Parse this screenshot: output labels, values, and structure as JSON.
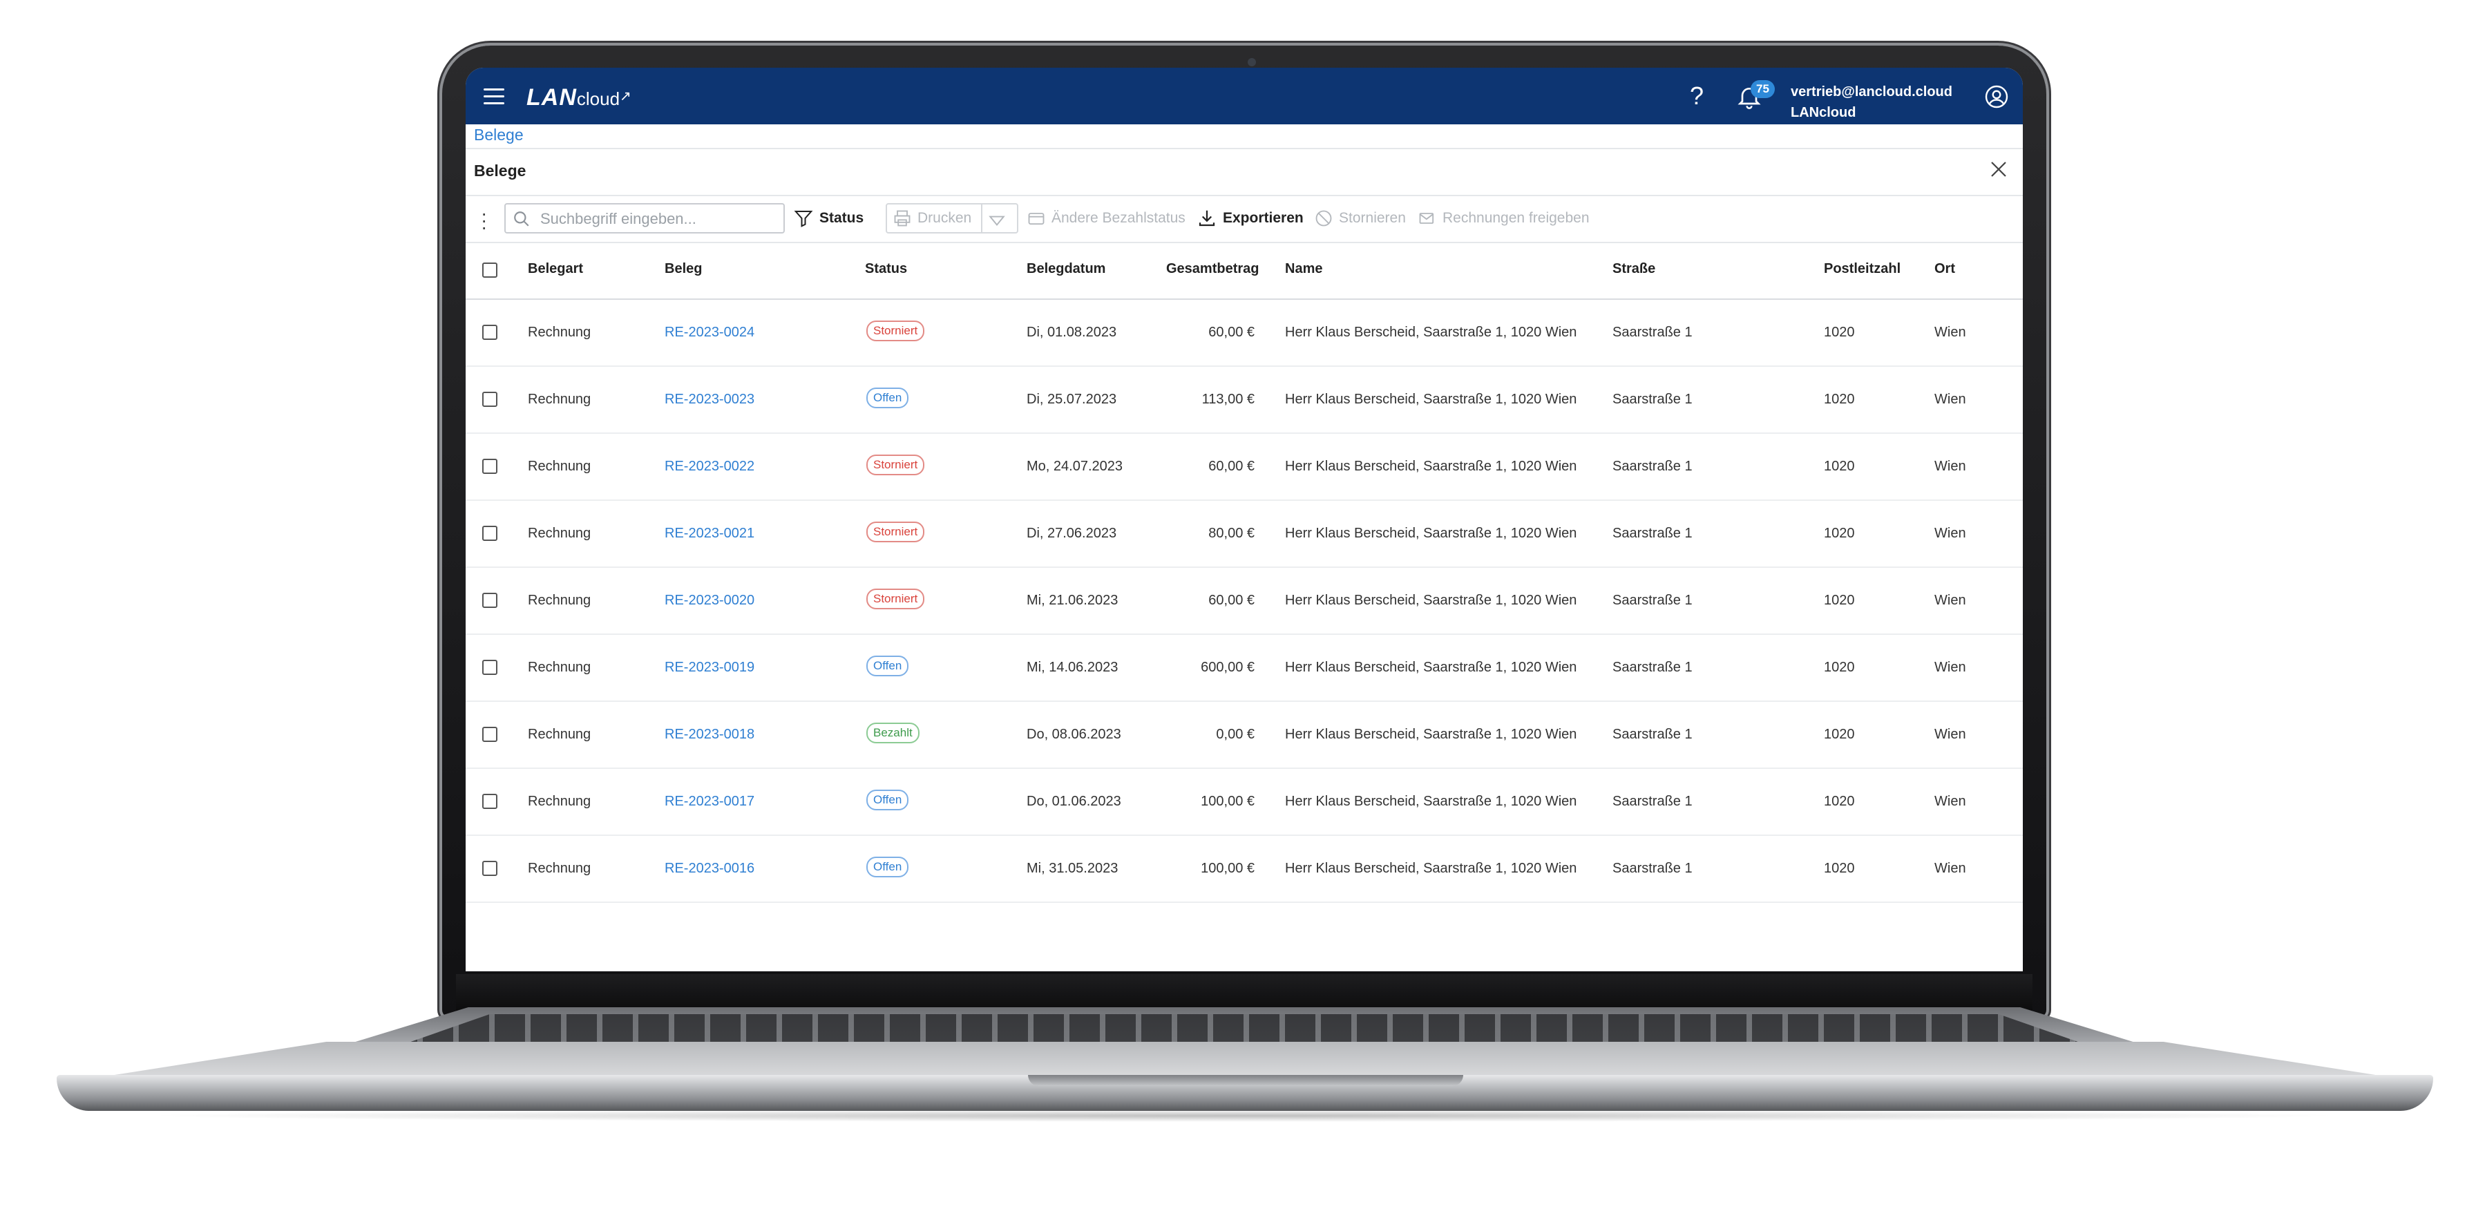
{
  "app": {
    "logo_main": "LAN",
    "logo_sub": "cloud",
    "logo_arrow": "↗",
    "help_label": "?",
    "notification_count": "75",
    "user_email": "vertrieb@lancloud.cloud",
    "user_company": "LANcloud"
  },
  "breadcrumb": "Belege",
  "page_title": "Belege",
  "toolbar": {
    "search_placeholder": "Suchbegriff eingeben...",
    "status_label": "Status",
    "print_label": "Drucken",
    "change_payment_label": "Ändere Bezahlstatus",
    "export_label": "Exportieren",
    "cancel_label": "Stornieren",
    "release_label": "Rechnungen freigeben"
  },
  "table": {
    "columns": [
      "Belegart",
      "Beleg",
      "Status",
      "Belegdatum",
      "Gesamtbetrag",
      "Name",
      "Straße",
      "Postleitzahl",
      "Ort"
    ],
    "rows": [
      {
        "type": "Rechnung",
        "id": "RE-2023-0024",
        "status": "Storniert",
        "status_kind": "storniert",
        "date": "Di, 01.08.2023",
        "amount": "60,00 €",
        "name": "Herr Klaus Berscheid, Saarstraße 1, 1020 Wien",
        "street": "Saarstraße 1",
        "zip": "1020",
        "city": "Wien"
      },
      {
        "type": "Rechnung",
        "id": "RE-2023-0023",
        "status": "Offen",
        "status_kind": "offen",
        "date": "Di, 25.07.2023",
        "amount": "113,00 €",
        "name": "Herr Klaus Berscheid, Saarstraße 1, 1020 Wien",
        "street": "Saarstraße 1",
        "zip": "1020",
        "city": "Wien"
      },
      {
        "type": "Rechnung",
        "id": "RE-2023-0022",
        "status": "Storniert",
        "status_kind": "storniert",
        "date": "Mo, 24.07.2023",
        "amount": "60,00 €",
        "name": "Herr Klaus Berscheid, Saarstraße 1, 1020 Wien",
        "street": "Saarstraße 1",
        "zip": "1020",
        "city": "Wien"
      },
      {
        "type": "Rechnung",
        "id": "RE-2023-0021",
        "status": "Storniert",
        "status_kind": "storniert",
        "date": "Di, 27.06.2023",
        "amount": "80,00 €",
        "name": "Herr Klaus Berscheid, Saarstraße 1, 1020 Wien",
        "street": "Saarstraße 1",
        "zip": "1020",
        "city": "Wien"
      },
      {
        "type": "Rechnung",
        "id": "RE-2023-0020",
        "status": "Storniert",
        "status_kind": "storniert",
        "date": "Mi, 21.06.2023",
        "amount": "60,00 €",
        "name": "Herr Klaus Berscheid, Saarstraße 1, 1020 Wien",
        "street": "Saarstraße 1",
        "zip": "1020",
        "city": "Wien"
      },
      {
        "type": "Rechnung",
        "id": "RE-2023-0019",
        "status": "Offen",
        "status_kind": "offen",
        "date": "Mi, 14.06.2023",
        "amount": "600,00 €",
        "name": "Herr Klaus Berscheid, Saarstraße 1, 1020 Wien",
        "street": "Saarstraße 1",
        "zip": "1020",
        "city": "Wien"
      },
      {
        "type": "Rechnung",
        "id": "RE-2023-0018",
        "status": "Bezahlt",
        "status_kind": "bezahlt",
        "date": "Do, 08.06.2023",
        "amount": "0,00 €",
        "name": "Herr Klaus Berscheid, Saarstraße 1, 1020 Wien",
        "street": "Saarstraße 1",
        "zip": "1020",
        "city": "Wien"
      },
      {
        "type": "Rechnung",
        "id": "RE-2023-0017",
        "status": "Offen",
        "status_kind": "offen",
        "date": "Do, 01.06.2023",
        "amount": "100,00 €",
        "name": "Herr Klaus Berscheid, Saarstraße 1, 1020 Wien",
        "street": "Saarstraße 1",
        "zip": "1020",
        "city": "Wien"
      },
      {
        "type": "Rechnung",
        "id": "RE-2023-0016",
        "status": "Offen",
        "status_kind": "offen",
        "date": "Mi, 31.05.2023",
        "amount": "100,00 €",
        "name": "Herr Klaus Berscheid, Saarstraße 1, 1020 Wien",
        "street": "Saarstraße 1",
        "zip": "1020",
        "city": "Wien"
      }
    ]
  },
  "colors": {
    "header_bg": "#0d3572",
    "link": "#2f7fd2",
    "storniert": "#d9423b",
    "offen": "#2f7fd2",
    "bezahlt": "#3e9b4c"
  }
}
